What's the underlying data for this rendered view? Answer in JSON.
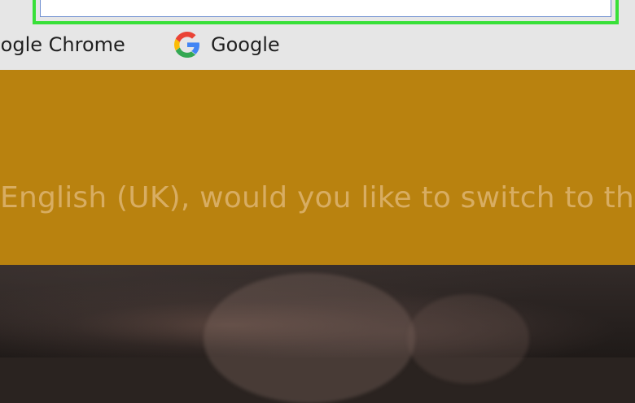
{
  "bookmarks": [
    {
      "label": "oogle Chrome",
      "icon": "chrome-bookmark-icon"
    },
    {
      "label": "Google",
      "icon": "google-g-icon"
    }
  ],
  "banner": {
    "text": "English (UK), would you like to switch to th"
  },
  "colors": {
    "highlight": "#38e038",
    "banner": "#b9820f",
    "banner_text": "#d8ad62"
  }
}
